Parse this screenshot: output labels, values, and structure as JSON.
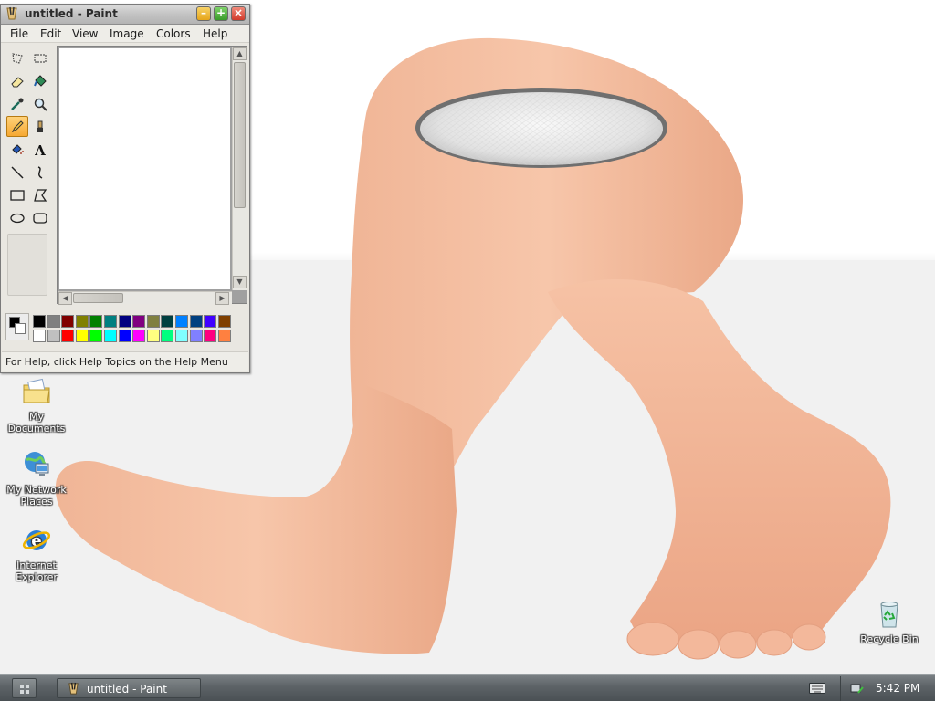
{
  "desktop": {
    "icons": [
      {
        "label_line1": "My",
        "label_line2": "Documents",
        "icon": "folder-documents-icon"
      },
      {
        "label_line1": "My Network",
        "label_line2": "Places",
        "icon": "network-computer-icon"
      },
      {
        "label_line1": "Internet",
        "label_line2": "Explorer",
        "icon": "internet-explorer-icon"
      },
      {
        "label_line1": "Recycle Bin",
        "label_line2": "",
        "icon": "recycle-bin-icon"
      }
    ]
  },
  "paint": {
    "title": "untitled - Paint",
    "window_buttons": {
      "minimize": "–",
      "maximize": "+",
      "close": "×"
    },
    "menu": [
      "File",
      "Edit",
      "View",
      "Image",
      "Colors",
      "Help"
    ],
    "tools": [
      "free-select-icon",
      "rect-select-icon",
      "eraser-icon",
      "fill-bucket-icon",
      "color-picker-icon",
      "magnifier-icon",
      "pencil-icon",
      "brush-icon",
      "airbrush-icon",
      "text-icon",
      "line-icon",
      "curve-icon",
      "rectangle-icon",
      "polygon-icon",
      "ellipse-icon",
      "rounded-rect-icon"
    ],
    "active_tool": "pencil-icon",
    "foreground_color": "#000000",
    "background_color": "#ffffff",
    "palette_row1": [
      "#000000",
      "#808080",
      "#800000",
      "#808000",
      "#008000",
      "#008080",
      "#000080",
      "#800080",
      "#808040",
      "#004040",
      "#0080ff",
      "#004080",
      "#4000ff",
      "#804000"
    ],
    "palette_row2": [
      "#ffffff",
      "#c0c0c0",
      "#ff0000",
      "#ffff00",
      "#00ff00",
      "#00ffff",
      "#0000ff",
      "#ff00ff",
      "#ffff80",
      "#00ff80",
      "#80ffff",
      "#8080ff",
      "#ff0080",
      "#ff8040"
    ],
    "status": "For Help, click Help Topics on the Help Menu"
  },
  "taskbar": {
    "task_label": "untitled - Paint",
    "clock": "5:42 PM"
  },
  "colors": {
    "skin": "#f2b99a",
    "taskbar": "#5d6367"
  }
}
